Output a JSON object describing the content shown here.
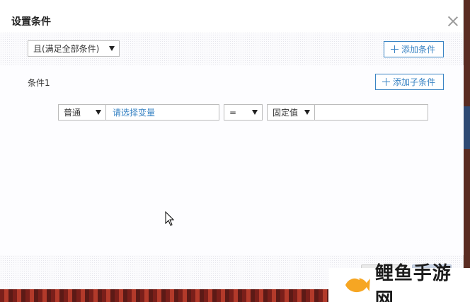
{
  "dialog": {
    "title": "设置条件"
  },
  "logic_select": {
    "value": "且(满足全部条件)"
  },
  "add_condition_button": {
    "label": "添加条件"
  },
  "condition": {
    "label": "条件1",
    "add_sub_condition_label": "添加子条件",
    "type_select": "普通",
    "variable_placeholder": "请选择变量",
    "operator_select": "=",
    "value_type_select": "固定值",
    "value": ""
  },
  "watermark": {
    "text": "鲤鱼手游网"
  },
  "colors": {
    "accent": "#3a84c4",
    "fish_orange": "#f6a623"
  }
}
